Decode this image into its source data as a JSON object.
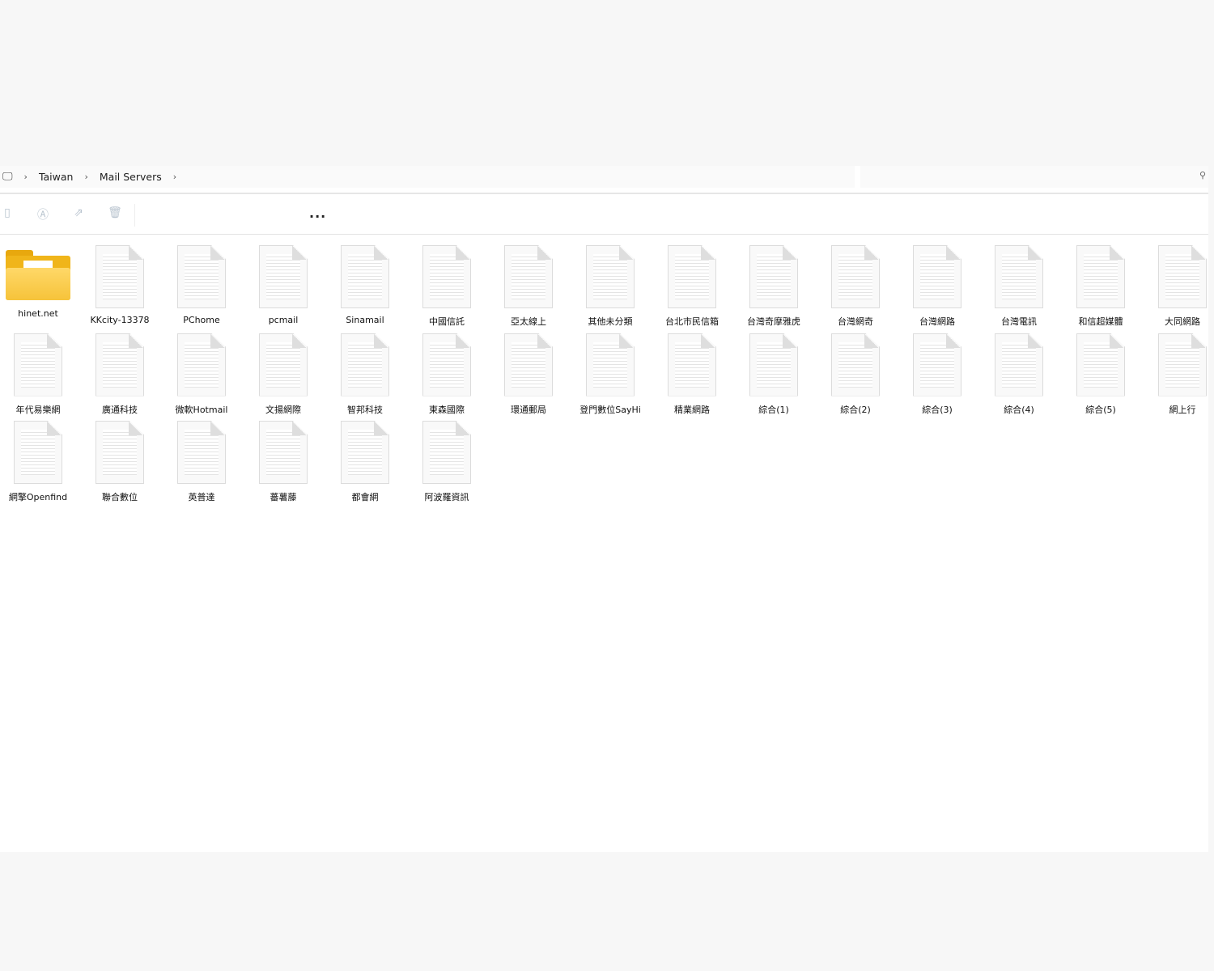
{
  "breadcrumb": {
    "items": [
      "Taiwan",
      "Mail Servers"
    ]
  },
  "toolbar": {
    "more": "..."
  },
  "items": [
    {
      "name": "hinet.net",
      "type": "folder"
    },
    {
      "name": "KKcity-13378",
      "type": "file"
    },
    {
      "name": "PChome",
      "type": "file"
    },
    {
      "name": "pcmail",
      "type": "file"
    },
    {
      "name": "Sinamail",
      "type": "file"
    },
    {
      "name": "中國信託",
      "type": "file"
    },
    {
      "name": "亞太線上",
      "type": "file"
    },
    {
      "name": "其他未分類",
      "type": "file"
    },
    {
      "name": "台北市民信箱",
      "type": "file"
    },
    {
      "name": "台灣奇摩雅虎",
      "type": "file"
    },
    {
      "name": "台灣網奇",
      "type": "file"
    },
    {
      "name": "台灣網路",
      "type": "file"
    },
    {
      "name": "台灣電訊",
      "type": "file"
    },
    {
      "name": "和信超媒體",
      "type": "file"
    },
    {
      "name": "大同網路",
      "type": "file"
    },
    {
      "name": "年代易樂網",
      "type": "file"
    },
    {
      "name": "廣通科技",
      "type": "file"
    },
    {
      "name": "微軟Hotmail",
      "type": "file"
    },
    {
      "name": "文揚網際",
      "type": "file"
    },
    {
      "name": "智邦科技",
      "type": "file"
    },
    {
      "name": "東森國際",
      "type": "file"
    },
    {
      "name": "環通郵局",
      "type": "file"
    },
    {
      "name": "登門數位SayHi",
      "type": "file"
    },
    {
      "name": "精業網路",
      "type": "file"
    },
    {
      "name": "綜合(1)",
      "type": "file"
    },
    {
      "name": "綜合(2)",
      "type": "file"
    },
    {
      "name": "綜合(3)",
      "type": "file"
    },
    {
      "name": "綜合(4)",
      "type": "file"
    },
    {
      "name": "綜合(5)",
      "type": "file"
    },
    {
      "name": "網上行",
      "type": "file"
    },
    {
      "name": "網擎Openfind",
      "type": "file"
    },
    {
      "name": "聯合數位",
      "type": "file"
    },
    {
      "name": "英普達",
      "type": "file"
    },
    {
      "name": "蕃薯藤",
      "type": "file"
    },
    {
      "name": "都會網",
      "type": "file"
    },
    {
      "name": "阿波羅資訊",
      "type": "file"
    }
  ]
}
